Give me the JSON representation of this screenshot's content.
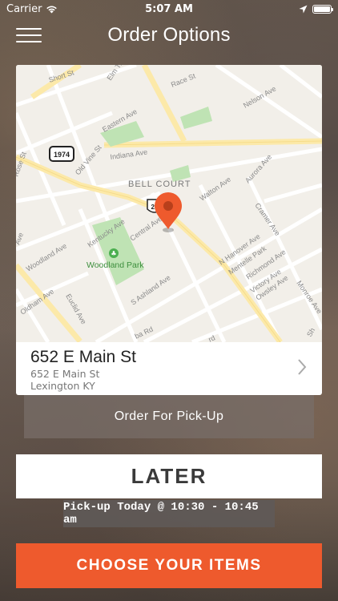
{
  "status_bar": {
    "carrier": "Carrier",
    "time": "5:07 AM",
    "battery_level": 1.0
  },
  "header": {
    "title": "Order Options",
    "menu_icon": "hamburger-icon"
  },
  "map": {
    "neighborhood": "BELL COURT",
    "park": "Woodland Park",
    "route_shield": "1974",
    "us_shield": "25",
    "streets": [
      "Short St",
      "Elm Tree",
      "Race St",
      "Nelson Ave",
      "Eastern Ave",
      "Indiana Ave",
      "Old Vine St",
      "Walton Ave",
      "Aurora Ave",
      "Cramer Ave",
      "Kentucky Ave",
      "Central Ave",
      "Woodland Ave",
      "N Hanover Ave",
      "Mentelle Park",
      "Richmond Ave",
      "Victory Ave",
      "Owsley Ave",
      "S Ashland Ave",
      "Monroe Ave",
      "Oldham Ave",
      "Euclid Ave",
      "Rose St",
      "Ave",
      "ba Rd",
      "rd",
      "Sh"
    ],
    "pin_color": "#ee5a2d",
    "pin_icon": "location-pin-icon"
  },
  "location": {
    "name": "652 E Main St",
    "address_line1": "652 E Main St",
    "address_line2": "Lexington KY",
    "chevron_icon": "chevron-right-icon"
  },
  "order_type": {
    "label": "Order For Pick-Up"
  },
  "timing": {
    "label": "LATER",
    "pickup_time": "Pick-up Today @ 10:30 - 10:45 am"
  },
  "cta": {
    "label": "CHOOSE YOUR ITEMS",
    "color": "#ee5a2d"
  }
}
